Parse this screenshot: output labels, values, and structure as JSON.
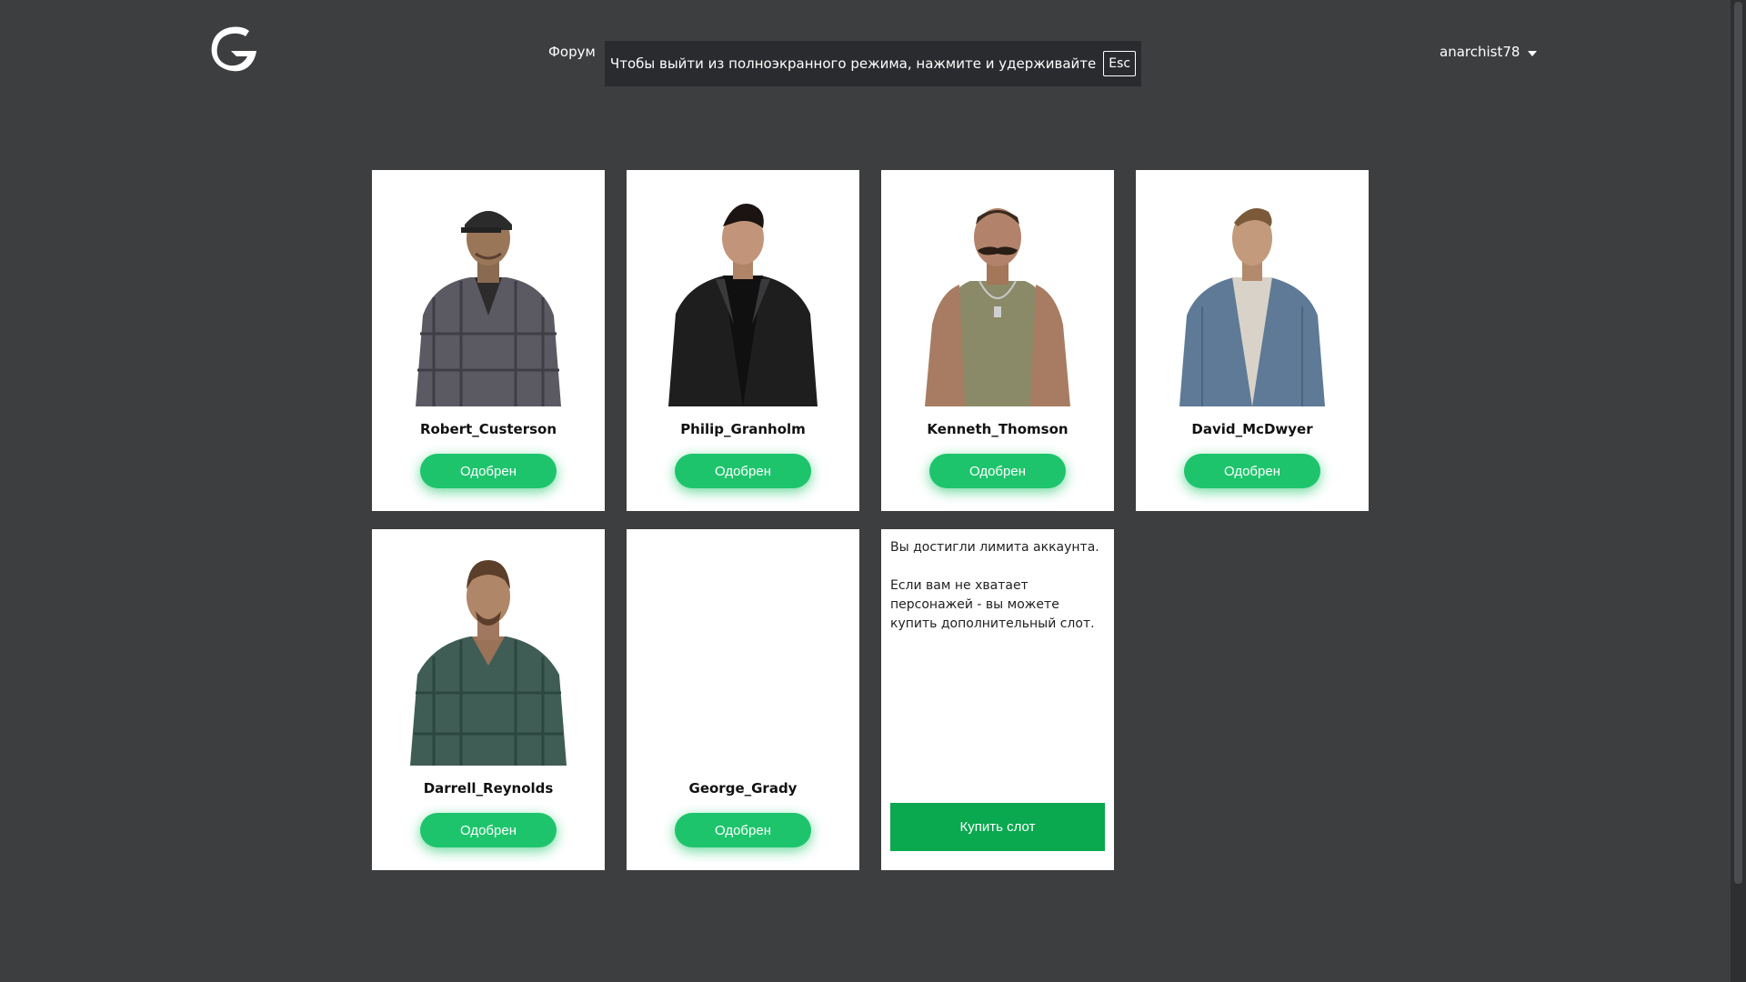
{
  "header": {
    "nav_forum": "Форум",
    "fullscreen_notice": "Чтобы выйти из полноэкранного режима, нажмите и удерживайте",
    "esc_key": "Esc",
    "username": "anarchist78"
  },
  "characters": [
    {
      "name": "Robert_Custerson",
      "status": "Одобрен",
      "skin": "cap-plaid"
    },
    {
      "name": "Philip_Granholm",
      "status": "Одобрен",
      "skin": "leather-jacket"
    },
    {
      "name": "Kenneth_Thomson",
      "status": "Одобрен",
      "skin": "tank-top-mustache"
    },
    {
      "name": "David_McDwyer",
      "status": "Одобрен",
      "skin": "denim-vest"
    },
    {
      "name": "Darrell_Reynolds",
      "status": "Одобрен",
      "skin": "green-plaid"
    },
    {
      "name": "George_Grady",
      "status": "Одобрен",
      "skin": "none"
    }
  ],
  "limit_card": {
    "line1": "Вы достигли лимита аккаунта.",
    "line2": "Если вам не хватает персонажей - вы можете купить дополнительный слот.",
    "buy_button": "Купить слот"
  },
  "colors": {
    "background": "#3d3e40",
    "approved_green": "#1ec46c",
    "buy_green": "#0aa84f"
  }
}
